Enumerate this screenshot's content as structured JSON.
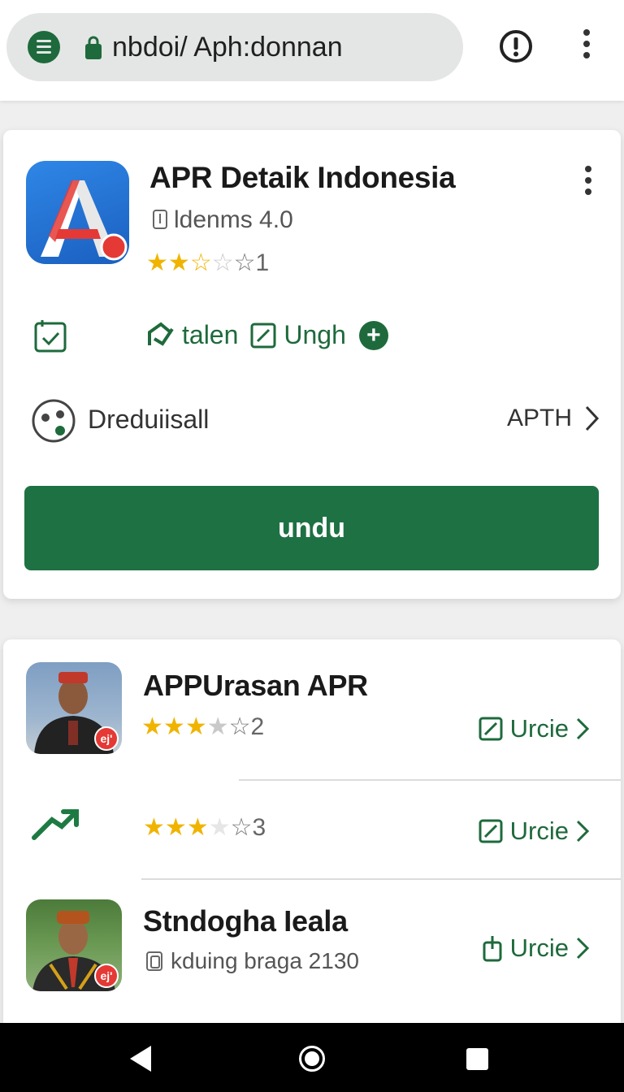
{
  "browser": {
    "url": "nbdoi/ Aph:donnan",
    "site_icon": "tab-menu-icon",
    "lock_icon": "lock-icon",
    "alert_icon": "alert-circle-icon",
    "menu_icon": "more-vert-icon"
  },
  "main_app": {
    "title": "APR Detaik Indonesia",
    "version": "ldenms 4.0",
    "rating": {
      "filled": 2,
      "half": 1,
      "total": 5,
      "count": "1"
    },
    "actions": [
      {
        "label": "talen",
        "icon": "refresh-share-icon"
      },
      {
        "label": "Ungh",
        "icon": "edit-square-icon"
      }
    ],
    "developer": "Dreduiisall",
    "developer_link": "APTH",
    "install_label": "undu",
    "colors": {
      "primary_green": "#1e7143",
      "star": "#f0b400"
    }
  },
  "list": [
    {
      "title": "APPUrasan APR",
      "rating": {
        "filled": 3,
        "total": 5,
        "count": "2"
      },
      "action_label": "Urcie"
    },
    {
      "title": "",
      "rating": {
        "filled": 3,
        "total": 5,
        "count": "3"
      },
      "action_label": "Urcie"
    },
    {
      "title": "Stndogha Ieala",
      "subtitle": "kduing braga 2130",
      "action_label": "Urcie"
    }
  ],
  "badge_text": "ej'"
}
